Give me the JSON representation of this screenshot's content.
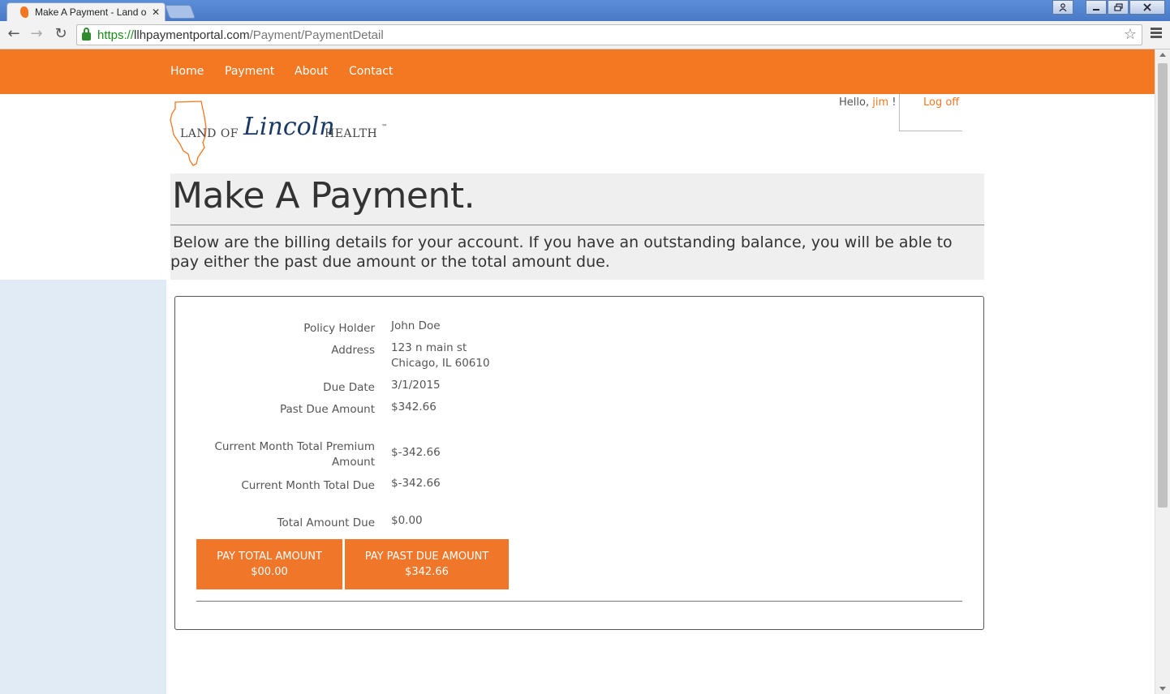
{
  "browser": {
    "tab_title": "Make A Payment - Land o",
    "url_scheme": "https://",
    "url_host": "llhpaymentportal.com",
    "url_path": "/Payment/PaymentDetail",
    "window_controls": [
      "user-icon",
      "minimize-icon",
      "restore-icon",
      "close-icon"
    ]
  },
  "nav": {
    "items": [
      "Home",
      "Payment",
      "About",
      "Contact"
    ]
  },
  "header": {
    "logo": {
      "land_of": "LAND OF",
      "lincoln": "Lincoln",
      "health": "HEALTH",
      "tm": "™"
    },
    "greeting_prefix": "Hello,",
    "username": "jim",
    "greeting_suffix": "!",
    "logoff": "Log off"
  },
  "page": {
    "title": "Make A Payment.",
    "intro": "Below are the billing details for your account. If you have an outstanding balance, you will be able to pay either the past due amount or the total amount due."
  },
  "details": {
    "policy_holder_label": "Policy Holder",
    "policy_holder_value": "John  Doe",
    "address_label": "Address",
    "address_line1": "123 n main st",
    "address_line2": "Chicago, IL  60610",
    "due_date_label": "Due Date",
    "due_date_value": "3/1/2015",
    "past_due_label": "Past Due Amount",
    "past_due_value": "$342.66",
    "current_premium_label": "Current Month Total Premium Amount",
    "current_premium_value": "$-342.66",
    "current_due_label": "Current Month Total Due",
    "current_due_value": "$-342.66",
    "total_due_label": "Total Amount Due",
    "total_due_value": "$0.00"
  },
  "buttons": {
    "pay_total_label": "PAY TOTAL AMOUNT",
    "pay_total_amount": "$00.00",
    "pay_past_due_label": "PAY PAST DUE AMOUNT",
    "pay_past_due_amount": "$342.66"
  },
  "colors": {
    "brand_orange": "#f47721",
    "left_panel": "#e1ebf6",
    "title_block": "#efefef"
  }
}
